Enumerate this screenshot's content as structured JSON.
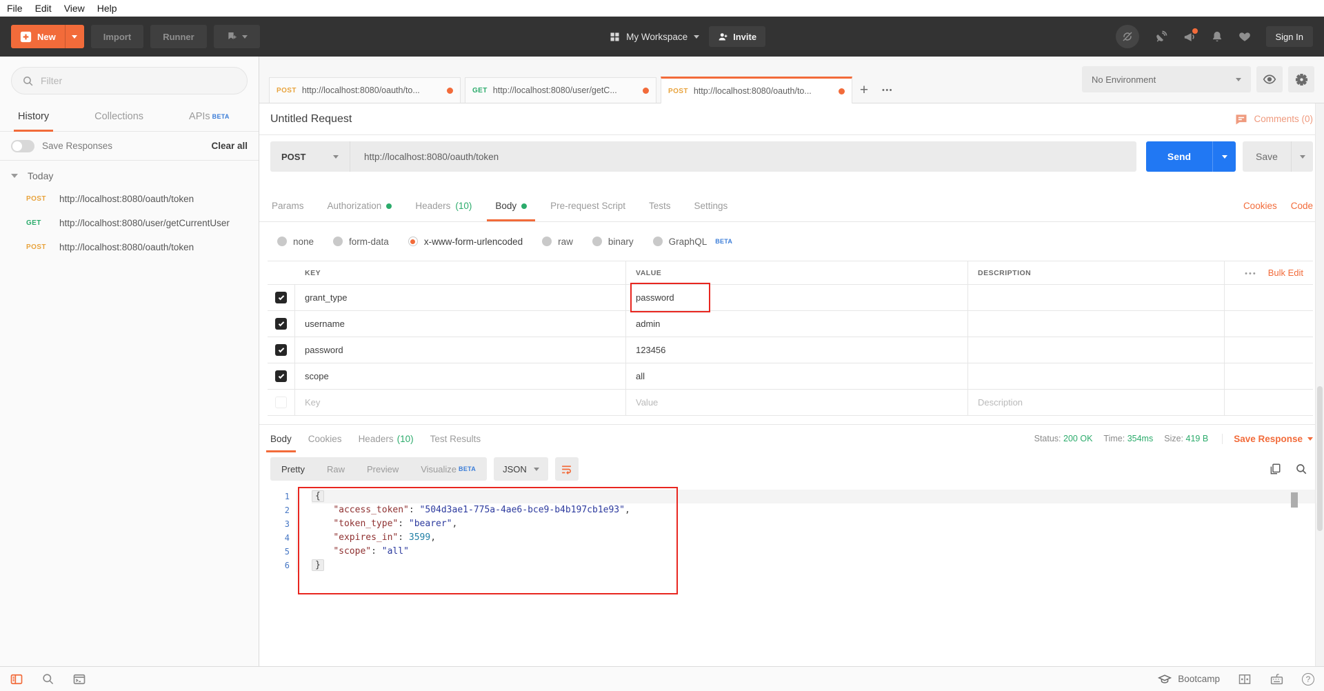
{
  "colors": {
    "accent": "#f26b3a",
    "post": "#e8a33d",
    "get": "#2bab6b",
    "green": "#2bab6b",
    "send_blue": "#2178f3",
    "beta_blue": "#3b7dd8",
    "annotation_red": "#e8261f"
  },
  "menu": {
    "items": [
      "File",
      "Edit",
      "View",
      "Help"
    ]
  },
  "toolbar": {
    "new_label": "New",
    "import_label": "Import",
    "runner_label": "Runner",
    "workspace_label": "My Workspace",
    "invite_label": "Invite",
    "signin_label": "Sign In"
  },
  "sidebar": {
    "filter_placeholder": "Filter",
    "tabs": [
      {
        "label": "History",
        "active": true
      },
      {
        "label": "Collections"
      },
      {
        "label": "APIs",
        "beta": "BETA"
      }
    ],
    "save_responses_label": "Save Responses",
    "clear_all_label": "Clear all",
    "history": {
      "group_label": "Today",
      "items": [
        {
          "method": "POST",
          "url": "http://localhost:8080/oauth/token"
        },
        {
          "method": "GET",
          "url": "http://localhost:8080/user/getCurrentUser"
        },
        {
          "method": "POST",
          "url": "http://localhost:8080/oauth/token"
        }
      ]
    }
  },
  "tabs": {
    "items": [
      {
        "method": "POST",
        "url": "http://localhost:8080/oauth/to..."
      },
      {
        "method": "GET",
        "url": "http://localhost:8080/user/getC..."
      },
      {
        "method": "POST",
        "url": "http://localhost:8080/oauth/to...",
        "active": true
      }
    ]
  },
  "environment": {
    "selected": "No Environment"
  },
  "request": {
    "title": "Untitled Request",
    "comments_label": "Comments (0)",
    "method": "POST",
    "url": "http://localhost:8080/oauth/token",
    "send_label": "Send",
    "save_label": "Save",
    "cookies_label": "Cookies",
    "code_label": "Code",
    "tabs": [
      {
        "label": "Params"
      },
      {
        "label": "Authorization",
        "dot": true
      },
      {
        "label": "Headers",
        "count": "(10)"
      },
      {
        "label": "Body",
        "dot": true,
        "active": true
      },
      {
        "label": "Pre-request Script"
      },
      {
        "label": "Tests"
      },
      {
        "label": "Settings"
      }
    ],
    "body_modes": [
      {
        "label": "none"
      },
      {
        "label": "form-data"
      },
      {
        "label": "x-www-form-urlencoded",
        "selected": true
      },
      {
        "label": "raw"
      },
      {
        "label": "binary"
      },
      {
        "label": "GraphQL",
        "beta": "BETA"
      }
    ],
    "table": {
      "headers": [
        "KEY",
        "VALUE",
        "DESCRIPTION"
      ],
      "bulk_edit_label": "Bulk Edit",
      "rows": [
        {
          "key": "grant_type",
          "value": "password",
          "checked": true,
          "annotated": true
        },
        {
          "key": "username",
          "value": "admin",
          "checked": true
        },
        {
          "key": "password",
          "value": "123456",
          "checked": true
        },
        {
          "key": "scope",
          "value": "all",
          "checked": true
        }
      ],
      "placeholder_row": {
        "key": "Key",
        "value": "Value",
        "description": "Description"
      }
    }
  },
  "response": {
    "tabs": [
      {
        "label": "Body",
        "active": true
      },
      {
        "label": "Cookies"
      },
      {
        "label": "Headers",
        "count": "(10)"
      },
      {
        "label": "Test Results"
      }
    ],
    "status_label": "Status:",
    "status_value": "200 OK",
    "time_label": "Time:",
    "time_value": "354ms",
    "size_label": "Size:",
    "size_value": "419 B",
    "save_response_label": "Save Response",
    "view_tabs": [
      {
        "label": "Pretty",
        "active": true
      },
      {
        "label": "Raw"
      },
      {
        "label": "Preview"
      },
      {
        "label": "Visualize",
        "beta": "BETA"
      }
    ],
    "format": "JSON",
    "code": {
      "lines": [
        {
          "n": 1,
          "highlight": true,
          "tokens": [
            {
              "t": "{",
              "c": "pln",
              "fold": true
            }
          ]
        },
        {
          "n": 2,
          "tokens": [
            {
              "t": "    ",
              "c": "pln"
            },
            {
              "t": "\"access_token\"",
              "c": "key"
            },
            {
              "t": ": ",
              "c": "pln"
            },
            {
              "t": "\"504d3ae1-775a-4ae6-bce9-b4b197cb1e93\"",
              "c": "str"
            },
            {
              "t": ",",
              "c": "pln"
            }
          ]
        },
        {
          "n": 3,
          "tokens": [
            {
              "t": "    ",
              "c": "pln"
            },
            {
              "t": "\"token_type\"",
              "c": "key"
            },
            {
              "t": ": ",
              "c": "pln"
            },
            {
              "t": "\"bearer\"",
              "c": "str"
            },
            {
              "t": ",",
              "c": "pln"
            }
          ]
        },
        {
          "n": 4,
          "tokens": [
            {
              "t": "    ",
              "c": "pln"
            },
            {
              "t": "\"expires_in\"",
              "c": "key"
            },
            {
              "t": ": ",
              "c": "pln"
            },
            {
              "t": "3599",
              "c": "num"
            },
            {
              "t": ",",
              "c": "pln"
            }
          ]
        },
        {
          "n": 5,
          "tokens": [
            {
              "t": "    ",
              "c": "pln"
            },
            {
              "t": "\"scope\"",
              "c": "key"
            },
            {
              "t": ": ",
              "c": "pln"
            },
            {
              "t": "\"all\"",
              "c": "str"
            }
          ]
        },
        {
          "n": 6,
          "tokens": [
            {
              "t": "}",
              "c": "pln",
              "fold": true
            }
          ]
        }
      ]
    }
  },
  "statusbar": {
    "bootcamp_label": "Bootcamp"
  }
}
